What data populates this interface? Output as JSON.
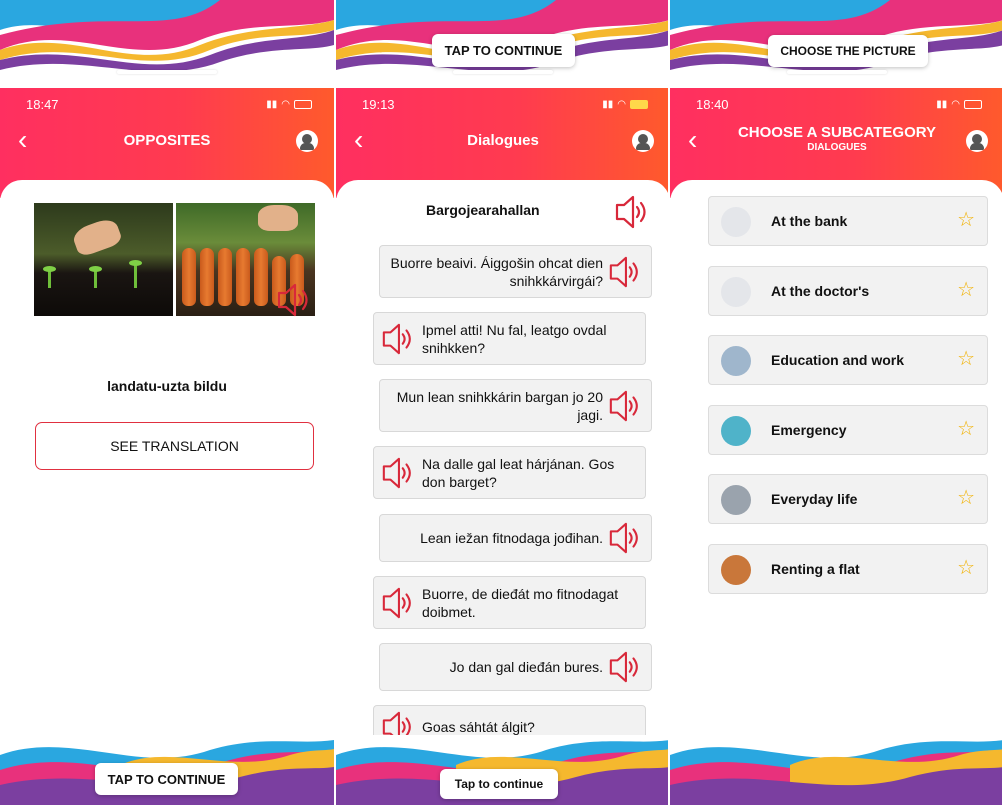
{
  "panels": [
    {
      "top_button": "",
      "bottom_button": "TAP TO CONTINUE",
      "status_time": "18:47",
      "title": "OPPOSITES",
      "phrase": "landatu-uzta bildu",
      "translation_button": "SEE TRANSLATION"
    },
    {
      "top_button": "TAP TO CONTINUE",
      "bottom_button": "Tap to continue",
      "status_time": "19:13",
      "title": "Dialogues",
      "dialogue_title": "Bargojearahallan",
      "lines": [
        {
          "text": "Buorre beaivi. Áiggošin ohcat dien snihkkárvirgái?",
          "side": "right"
        },
        {
          "text": "Ipmel atti! Nu fal, leatgo ovdal snihkken?",
          "side": "left"
        },
        {
          "text": "Mun lean snihkkárin bargan jo 20 jagi.",
          "side": "right"
        },
        {
          "text": "Na dalle gal leat hárjánan. Gos don barget?",
          "side": "left"
        },
        {
          "text": "Lean iežan fitnodaga jođihan.",
          "side": "right"
        },
        {
          "text": "Buorre, de dieđát mo fitnodagat doibmet.",
          "side": "left"
        },
        {
          "text": "Jo dan gal dieđán bures.",
          "side": "right"
        },
        {
          "text": "Goas sáhtát álgit?",
          "side": "left"
        }
      ]
    },
    {
      "top_button": "CHOOSE THE PICTURE",
      "status_time": "18:40",
      "title": "CHOOSE A SUBCATEGORY",
      "subtitle": "DIALOGUES",
      "categories": [
        {
          "label": "At the bank",
          "thumb_color": "#e4e6ea"
        },
        {
          "label": "At the doctor's",
          "thumb_color": "#e4e6ea"
        },
        {
          "label": "Education and work",
          "thumb_color": "#9fb6cc"
        },
        {
          "label": "Emergency",
          "thumb_color": "#4fb3c9"
        },
        {
          "label": "Everyday life",
          "thumb_color": "#9aa3ad"
        },
        {
          "label": "Renting a flat",
          "thumb_color": "#c9773a"
        }
      ]
    }
  ],
  "colors": {
    "header_start": "#ff2f60",
    "header_end": "#ff5a2c",
    "speaker": "#d8283a",
    "star": "#f2b100"
  }
}
